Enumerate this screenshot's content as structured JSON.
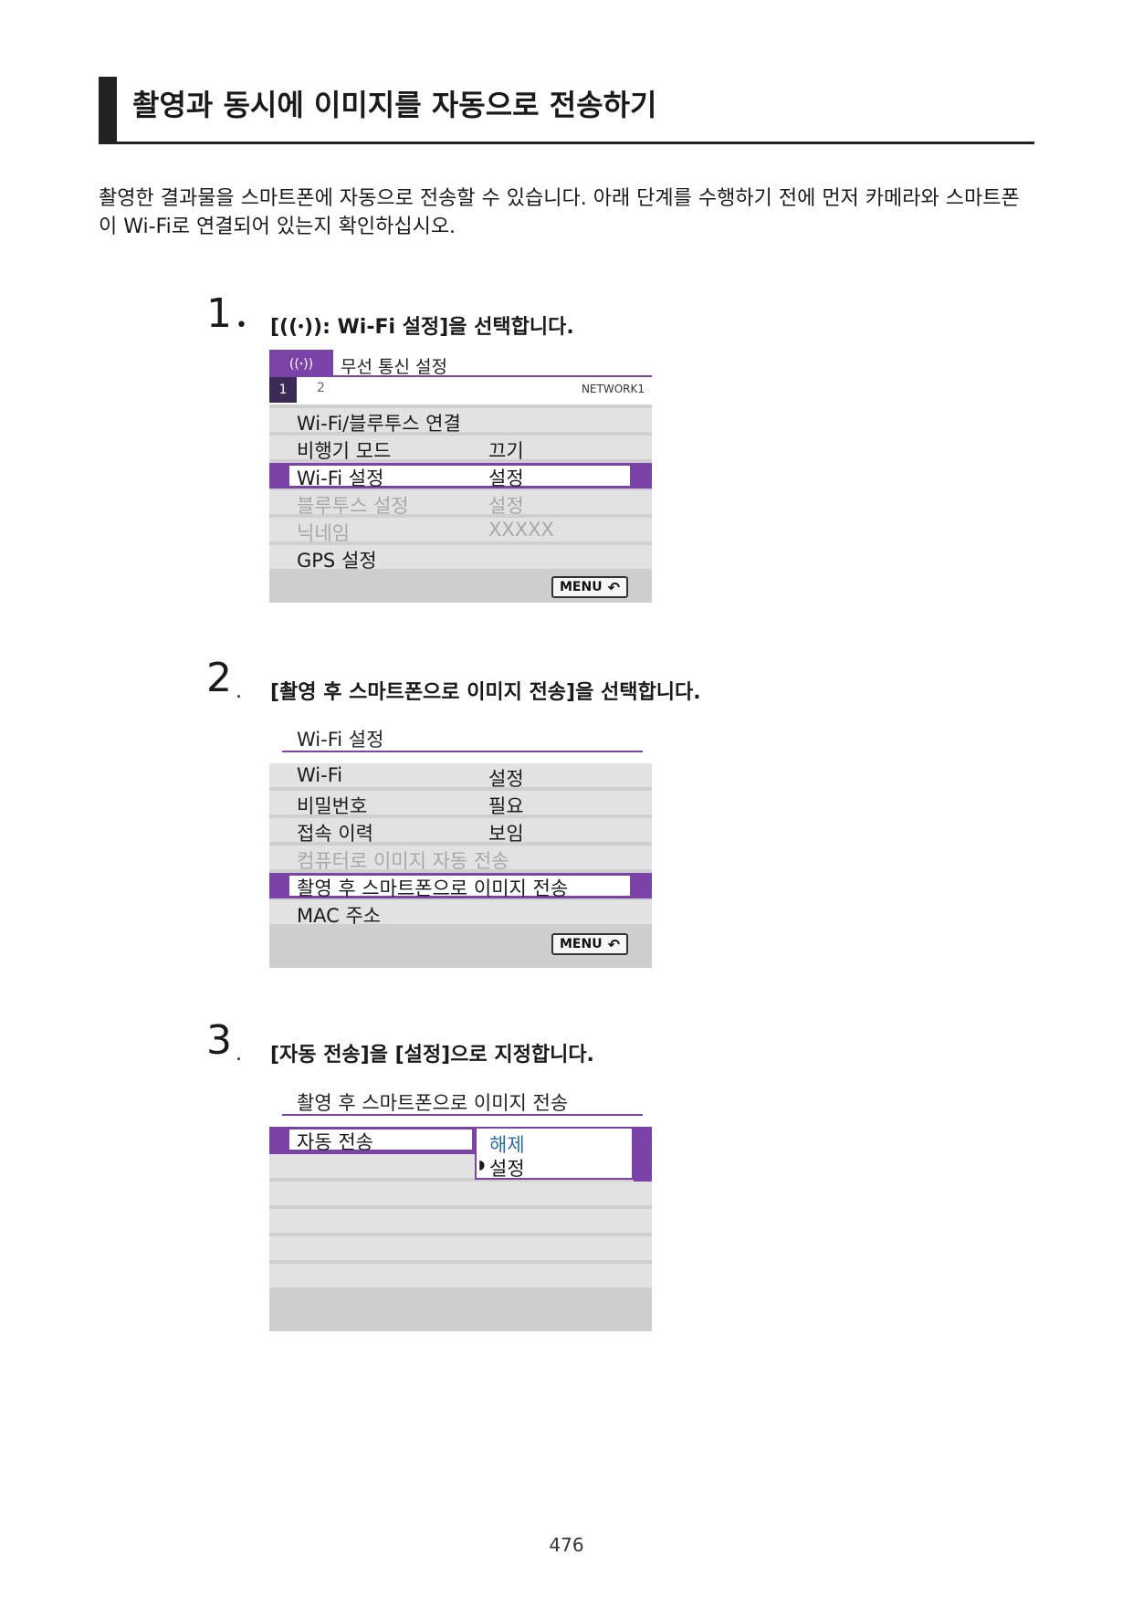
{
  "page": {
    "title": "촬영과 동시에 이미지를 자동으로 전송하기",
    "intro": "촬영한 결과물을 스마트폰에 자동으로 전송할 수 있습니다. 아래 단계를 수행하기 전에 먼저 카메라와 스마트폰이 Wi-Fi로 연결되어 있는지 확인하십시오.",
    "page_number": "476"
  },
  "steps": [
    {
      "num": "1",
      "text": "[((ꞏ)): Wi-Fi 설정]을 선택합니다."
    },
    {
      "num": "2",
      "text": "[촬영 후 스마트폰으로 이미지 전송]을 선택합니다."
    },
    {
      "num": "3",
      "text": "[자동 전송]을 [설정]으로 지정합니다."
    }
  ],
  "screen1": {
    "icon": "((ꞏ))",
    "title": "무선 통신 설정",
    "tab1": "1",
    "tab2": "2",
    "network": "NETWORK1",
    "rows": [
      {
        "label": "Wi-Fi/블루투스 연결",
        "value": ""
      },
      {
        "label": "비행기 모드",
        "value": "끄기"
      },
      {
        "label": "Wi-Fi 설정",
        "value": "설정"
      },
      {
        "label": "블루투스 설정",
        "value": "설정"
      },
      {
        "label": "닉네임",
        "value": "XXXXX"
      },
      {
        "label": "GPS 설정",
        "value": ""
      }
    ],
    "menu_label": "MENU",
    "menu_icon": "back-arrow"
  },
  "screen2": {
    "title": "Wi-Fi 설정",
    "rows": [
      {
        "label": "Wi-Fi",
        "value": "설정"
      },
      {
        "label": "비밀번호",
        "value": "필요"
      },
      {
        "label": "접속 이력",
        "value": "보임"
      },
      {
        "label": "컴퓨터로 이미지 자동 전송",
        "value": ""
      },
      {
        "label": "촬영 후 스마트폰으로 이미지 전송",
        "value": ""
      },
      {
        "label": "MAC 주소",
        "value": ""
      }
    ],
    "menu_label": "MENU"
  },
  "screen3": {
    "title": "촬영 후 스마트폰으로 이미지 전송",
    "row_label": "자동 전송",
    "options": [
      "해제",
      "설정"
    ],
    "option_colors": {
      "off": "#2a6fa8",
      "on": "#1a1a1a"
    }
  },
  "colors": {
    "accent": "#7b43a8",
    "row_bg": "#e2e2e2",
    "screen_bg": "#cfcfcf"
  }
}
